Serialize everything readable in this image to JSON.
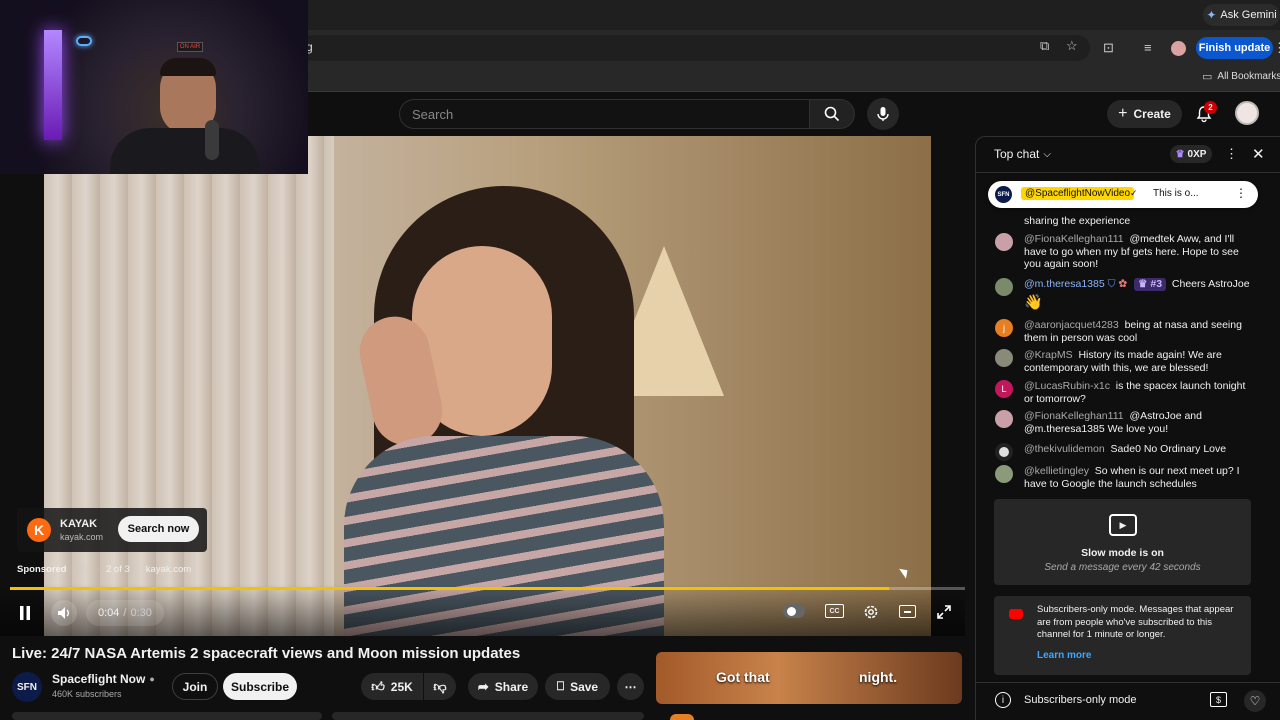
{
  "browser": {
    "ask_gemini": "Ask Gemini",
    "url_fragment": "g",
    "finish_update": "Finish update",
    "all_bookmarks": "All Bookmarks"
  },
  "webcam": {
    "on_air": "ON AIR"
  },
  "header": {
    "search_placeholder": "Search",
    "create_label": "Create",
    "notification_count": "2"
  },
  "ad": {
    "advertiser": "KAYAK",
    "domain": "kayak.com",
    "cta": "Search now",
    "sponsored": "Sponsored",
    "ad_position": "2 of 3",
    "ad_domain": "kayak.com"
  },
  "player": {
    "time_current": "0:04",
    "time_separator": "/",
    "time_total": "0:30",
    "progress": 0.92
  },
  "video": {
    "title": "Live: 24/7 NASA Artemis 2 spacecraft views and Moon mission updates",
    "channel_avatar_text": "SFN",
    "channel_name": "Spaceflight Now",
    "subscribers": "460K subscribers",
    "join_label": "Join",
    "subscribe_label": "Subscribe",
    "likes": "25K",
    "share_label": "Share",
    "save_label": "Save"
  },
  "recommendation": {
    "thumb_text_left": "Got that",
    "thumb_text_right": "night."
  },
  "chat": {
    "mode_label": "Top chat",
    "xp_label": "0XP",
    "pinned": {
      "avatar_text": "SFN",
      "author": "@SpaceflightNowVideo",
      "text": "This is o..."
    },
    "partial_message": "sharing the experience",
    "messages": [
      {
        "author": "@FionaKelleghan111",
        "text": "@medtek Aww, and I'll have to go when my bf gets here. Hope to see you again soon!",
        "avatar_color": "#c9a0a8"
      },
      {
        "author": "@m.theresa1385",
        "rank": "#3",
        "text": "Cheers AstroJoe",
        "emoji": "👋",
        "avatar_color": "#7a8a6a"
      },
      {
        "author": "@aaronjacquet4283",
        "text": "being at nasa and seeing them in person was cool",
        "avatar_color": "#e67e22",
        "avatar_letter": "j"
      },
      {
        "author": "@KrapMS",
        "text": "History its made again! We are contemporary with this, we are blessed!",
        "avatar_color": "#8a8a7a"
      },
      {
        "author": "@LucasRubin-x1c",
        "text": "is the spacex launch tonight or tomorrow?",
        "avatar_color": "#c2185b",
        "avatar_letter": "L"
      },
      {
        "author": "@FionaKelleghan111",
        "text": "@AstroJoe and @m.theresa1385 We love you!",
        "avatar_color": "#c9a0a8"
      },
      {
        "author": "@thekivulidemon",
        "text": "Sade0 No Ordinary Love",
        "avatar_color": "#e0e0e0"
      },
      {
        "author": "@kellietingley",
        "text": "So when is our next meet up? I have to Google the launch schedules",
        "avatar_color": "#8a9a7a"
      }
    ],
    "slow_mode": {
      "title": "Slow mode is on",
      "subtitle": "Send a message every 42 seconds"
    },
    "subscribers_notice": {
      "text": "Subscribers-only mode. Messages that appear are from people who've subscribed to this channel for 1 minute or longer.",
      "learn_more": "Learn more"
    },
    "footer_label": "Subscribers-only mode"
  }
}
